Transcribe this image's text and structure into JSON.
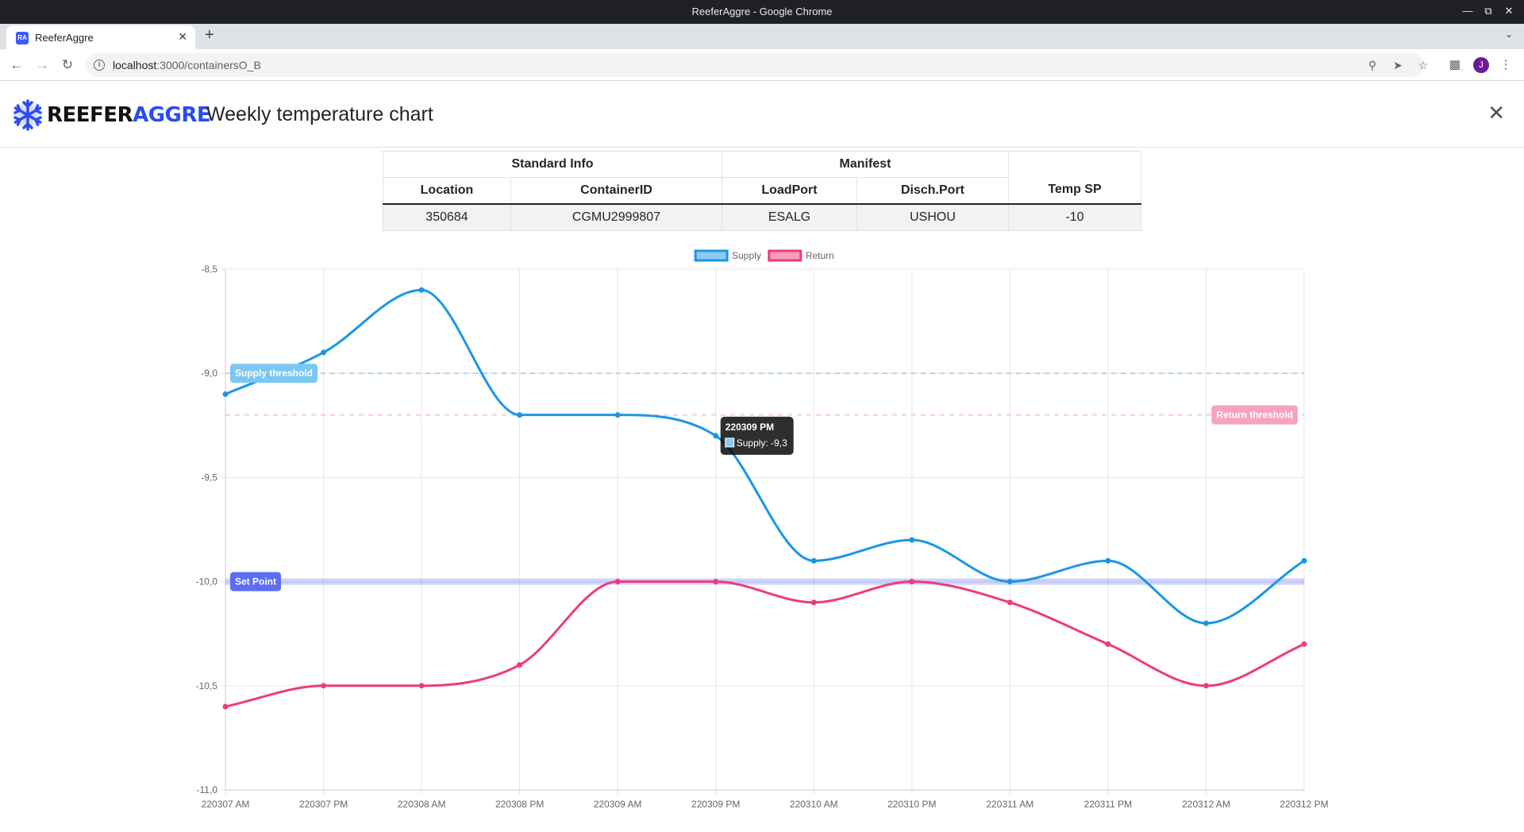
{
  "window": {
    "title": "ReeferAggre - Google Chrome",
    "minimize_icon": "minimize-icon",
    "restore_icon": "restore-icon",
    "close_icon": "close-icon"
  },
  "browser": {
    "tab_title": "ReeferAggre",
    "favicon_text": "RA",
    "url_host": "localhost",
    "url_path": ":3000/containersO_B",
    "profile_initial": "J"
  },
  "app": {
    "brand_part1": "REEFER",
    "brand_part2": "AGGRE",
    "page_title": "Weekly temperature chart",
    "brand_color": "#2a4bf2"
  },
  "info_table": {
    "group_headers": {
      "standard_info": "Standard Info",
      "manifest": "Manifest"
    },
    "columns": [
      "Location",
      "ContainerID",
      "LoadPort",
      "Disch.Port",
      "Temp SP"
    ],
    "row": [
      "350684",
      "CGMU2999807",
      "ESALG",
      "USHOU",
      "-10"
    ]
  },
  "chart_data": {
    "type": "line",
    "title": "",
    "xlabel": "",
    "ylabel": "",
    "categories": [
      "220307 AM",
      "220307 PM",
      "220308 AM",
      "220308 PM",
      "220309 AM",
      "220309 PM",
      "220310 AM",
      "220310 PM",
      "220311 AM",
      "220311 PM",
      "220312 AM",
      "220312 PM"
    ],
    "ylim": [
      -11.0,
      -8.5
    ],
    "yticks": [
      "-8,5",
      "-9,0",
      "-9,5",
      "-10,0",
      "-10,5",
      "-11,0"
    ],
    "ytick_values": [
      -8.5,
      -9.0,
      -9.5,
      -10.0,
      -10.5,
      -11.0
    ],
    "grid": true,
    "legend_position": "top",
    "series": [
      {
        "name": "Supply",
        "color": "#1a96e6",
        "fill": "#8ccaf2",
        "values": [
          -9.1,
          -8.9,
          -8.6,
          -9.2,
          -9.2,
          -9.3,
          -9.9,
          -9.8,
          -10.0,
          -9.9,
          -10.2,
          -9.9
        ]
      },
      {
        "name": "Return",
        "color": "#ee3a7f",
        "fill": "#f59cbf",
        "values": [
          -10.6,
          -10.5,
          -10.5,
          -10.4,
          -10.0,
          -10.0,
          -10.1,
          -10.0,
          -10.1,
          -10.3,
          -10.5,
          -10.3
        ]
      }
    ],
    "annotations": [
      {
        "label": "Supply threshold",
        "value": -9.0,
        "color": "#7cc6f2",
        "style": "dashed",
        "label_position": "left"
      },
      {
        "label": "Return threshold",
        "value": -9.2,
        "color": "#f5a3c2",
        "style": "dashed",
        "label_position": "right"
      },
      {
        "label": "Set Point",
        "value": -10.0,
        "color": "#5b6ef2",
        "style": "band",
        "label_position": "left"
      }
    ],
    "tooltip": {
      "title": "220309 PM",
      "text": "Supply: -9,3",
      "category_index": 5,
      "series_index": 0
    }
  }
}
